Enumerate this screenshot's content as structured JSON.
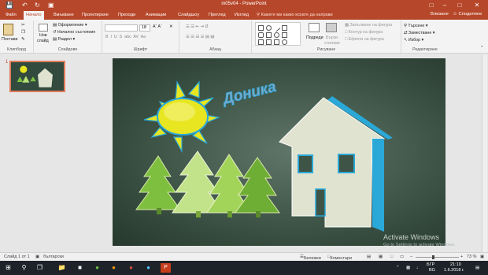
{
  "window": {
    "title": "m05v04 - PowerPoint",
    "qat": [
      "save-icon",
      "undo-icon",
      "redo-icon",
      "presentation-icon"
    ],
    "controls": [
      "minimize-icon",
      "maximize-icon",
      "close-icon"
    ]
  },
  "tabs": [
    "Файл",
    "Начало",
    "Вмъкване",
    "Проектиране",
    "Преходи",
    "Анимации",
    "Слайдшоу",
    "Преглед",
    "Изглед"
  ],
  "active_tab": "Начало",
  "tell_me": "Кажете ми какво искате да направи",
  "share": "Влизане",
  "share2": "Споделяне",
  "ribbon": {
    "clipboard": {
      "paste": "Постави",
      "label": "Клипборд"
    },
    "slides": {
      "new_slide_1": "Нов",
      "new_slide_2": "слайд",
      "layout": "Оформление",
      "reset": "Начално състояние",
      "section": "Раздел",
      "label": "Слайдове"
    },
    "font": {
      "size": "18",
      "label": "Шрифт"
    },
    "paragraph": {
      "label": "Абзац"
    },
    "drawing": {
      "arrange": "Подреди",
      "quick_styles_1": "Бързи",
      "quick_styles_2": "стилове",
      "fill": "Запълване на фигура",
      "outline": "Контур на фигура",
      "effects": "Ефекти на фигура",
      "label": "Рисуване"
    },
    "editing": {
      "find": "Търсене",
      "replace": "Заместване",
      "select": "Избор",
      "label": "Редактиране"
    }
  },
  "thumbnail": {
    "number": "1"
  },
  "slide": {
    "wordart": "Доника"
  },
  "watermark": {
    "line1": "Activate Windows",
    "line2": "Go to Settings to activate Windows."
  },
  "status": {
    "slide_info": "Слайд 1 от 1",
    "language": "български",
    "notes": "Бележки",
    "comments": "Коментари",
    "zoom": "73 %"
  },
  "taskbar": {
    "lang1": "БГР",
    "lang2": "BG",
    "time": "21:10",
    "date": "1.6.2018 г."
  },
  "colors": {
    "accent": "#b7472a",
    "slide_bg": "#3d5446",
    "tree_green": "#7fbf3f",
    "sun_yellow": "#e8e620",
    "house_face": "#dfe3cf",
    "house_side": "#2aa8d8"
  }
}
